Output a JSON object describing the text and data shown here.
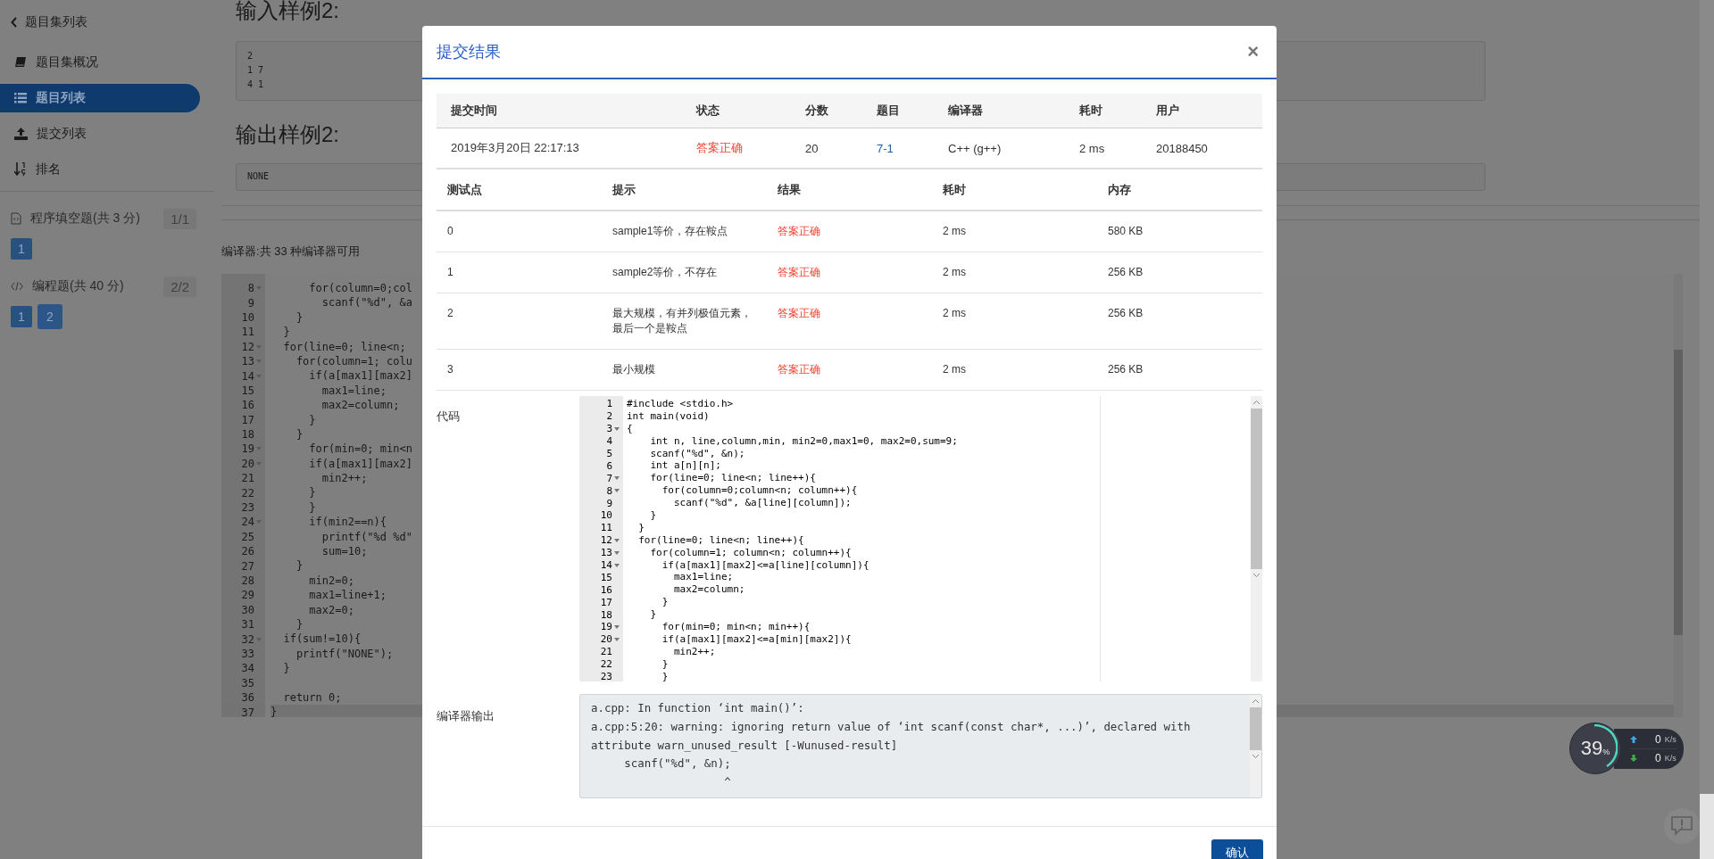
{
  "sidebar": {
    "back": {
      "label": "题目集列表"
    },
    "items": [
      {
        "label": "题目集概况",
        "selected": false
      },
      {
        "label": "题目列表",
        "selected": true
      },
      {
        "label": "提交列表",
        "selected": false
      },
      {
        "label": "排名",
        "selected": false
      }
    ],
    "sections": [
      {
        "title": "程序填空题(共 3 分)",
        "count": "1/1",
        "problems": [
          {
            "label": "1",
            "selected": false
          }
        ]
      },
      {
        "title": "编程题(共 40 分)",
        "count": "2/2",
        "problems": [
          {
            "label": "1",
            "selected": false
          },
          {
            "label": "2",
            "selected": true
          }
        ]
      }
    ]
  },
  "page": {
    "input_heading": "输入样例2:",
    "input_sample": [
      "2",
      "1 7",
      "4 1"
    ],
    "output_heading": "输出样例2:",
    "output_sample": "NONE",
    "compiler_note": "编译器:共 33 种编译器可用",
    "editor_lines": [
      {
        "n": "8",
        "code": "      for(column=0;col",
        "fold": true
      },
      {
        "n": "9",
        "code": "        scanf(\"%d\", &a",
        "fold": false
      },
      {
        "n": "10",
        "code": "    }",
        "fold": false
      },
      {
        "n": "11",
        "code": "  }",
        "fold": false
      },
      {
        "n": "12",
        "code": "  for(line=0; line<n;",
        "fold": true
      },
      {
        "n": "13",
        "code": "    for(column=1; colu",
        "fold": true
      },
      {
        "n": "14",
        "code": "      if(a[max1][max2]",
        "fold": true
      },
      {
        "n": "15",
        "code": "        max1=line;",
        "fold": false
      },
      {
        "n": "16",
        "code": "        max2=column;",
        "fold": false
      },
      {
        "n": "17",
        "code": "      }",
        "fold": false
      },
      {
        "n": "18",
        "code": "    }",
        "fold": false
      },
      {
        "n": "19",
        "code": "      for(min=0; min<n",
        "fold": true
      },
      {
        "n": "20",
        "code": "      if(a[max1][max2]",
        "fold": true
      },
      {
        "n": "21",
        "code": "        min2++;",
        "fold": false
      },
      {
        "n": "22",
        "code": "      }",
        "fold": false
      },
      {
        "n": "23",
        "code": "      }",
        "fold": false
      },
      {
        "n": "24",
        "code": "      if(min2==n){",
        "fold": true
      },
      {
        "n": "25",
        "code": "        printf(\"%d %d\"",
        "fold": false
      },
      {
        "n": "26",
        "code": "        sum=10;",
        "fold": false
      },
      {
        "n": "27",
        "code": "    }",
        "fold": false
      },
      {
        "n": "28",
        "code": "      min2=0;",
        "fold": false
      },
      {
        "n": "29",
        "code": "      max1=line+1;",
        "fold": false
      },
      {
        "n": "30",
        "code": "      max2=0;",
        "fold": false
      },
      {
        "n": "31",
        "code": "    }",
        "fold": false
      },
      {
        "n": "32",
        "code": "  if(sum!=10){",
        "fold": true
      },
      {
        "n": "33",
        "code": "    printf(\"NONE\");",
        "fold": false
      },
      {
        "n": "34",
        "code": "  }",
        "fold": false
      },
      {
        "n": "35",
        "fold": false
      },
      {
        "n": "36",
        "code": "  return 0;",
        "fold": false
      },
      {
        "n": "37",
        "code": "}",
        "fold": false
      }
    ]
  },
  "dialog": {
    "title": "提交结果",
    "close": "×",
    "summary": {
      "columns": [
        "提交时间",
        "状态",
        "分数",
        "题目",
        "编译器",
        "耗时",
        "用户"
      ],
      "cells": [
        {
          "text": "2019年3月20日 22:17:13",
          "kind": "plain"
        },
        {
          "text": "答案正确",
          "kind": "status"
        },
        {
          "text": "20",
          "kind": "plain"
        },
        {
          "text": "7-1",
          "kind": "link"
        },
        {
          "text": "C++ (g++)",
          "kind": "plain"
        },
        {
          "text": "2 ms",
          "kind": "plain"
        },
        {
          "text": "20188450",
          "kind": "plain"
        }
      ]
    },
    "tests": {
      "columns": [
        "测试点",
        "提示",
        "结果",
        "耗时",
        "内存"
      ],
      "rows": [
        {
          "case": "0",
          "hint": "sample1等价，存在鞍点",
          "result": "答案正确",
          "time": "2 ms",
          "memory": "580 KB"
        },
        {
          "case": "1",
          "hint": "sample2等价，不存在",
          "result": "答案正确",
          "time": "2 ms",
          "memory": "256 KB"
        },
        {
          "case": "2",
          "hint": "最大规模，有并列极值元素，最后一个是鞍点",
          "result": "答案正确",
          "time": "2 ms",
          "memory": "256 KB"
        },
        {
          "case": "3",
          "hint": "最小规模",
          "result": "答案正确",
          "time": "2 ms",
          "memory": "256 KB"
        }
      ]
    },
    "code_label": "代码",
    "code_lines": [
      {
        "n": "1",
        "code": "#include <stdio.h>",
        "fold": false
      },
      {
        "n": "2",
        "code": "int main(void)",
        "fold": false
      },
      {
        "n": "3",
        "code": "{",
        "fold": true
      },
      {
        "n": "4",
        "code": "    int n, line,column,min, min2=0,max1=0, max2=0,sum=9;",
        "fold": false
      },
      {
        "n": "5",
        "code": "    scanf(\"%d\", &n);",
        "fold": false
      },
      {
        "n": "6",
        "code": "    int a[n][n];",
        "fold": false
      },
      {
        "n": "7",
        "code": "    for(line=0; line<n; line++){",
        "fold": true
      },
      {
        "n": "8",
        "code": "      for(column=0;column<n; column++){",
        "fold": true
      },
      {
        "n": "9",
        "code": "        scanf(\"%d\", &a[line][column]);",
        "fold": false
      },
      {
        "n": "10",
        "code": "    }",
        "fold": false
      },
      {
        "n": "11",
        "code": "  }",
        "fold": false
      },
      {
        "n": "12",
        "code": "  for(line=0; line<n; line++){",
        "fold": true
      },
      {
        "n": "13",
        "code": "    for(column=1; column<n; column++){",
        "fold": true
      },
      {
        "n": "14",
        "code": "      if(a[max1][max2]<=a[line][column]){",
        "fold": true
      },
      {
        "n": "15",
        "code": "        max1=line;",
        "fold": false
      },
      {
        "n": "16",
        "code": "        max2=column;",
        "fold": false
      },
      {
        "n": "17",
        "code": "      }",
        "fold": false
      },
      {
        "n": "18",
        "code": "    }",
        "fold": false
      },
      {
        "n": "19",
        "code": "      for(min=0; min<n; min++){",
        "fold": true
      },
      {
        "n": "20",
        "code": "      if(a[max1][max2]<=a[min][max2]){",
        "fold": true
      },
      {
        "n": "21",
        "code": "        min2++;",
        "fold": false
      },
      {
        "n": "22",
        "code": "      }",
        "fold": false
      },
      {
        "n": "23",
        "code": "      }",
        "fold": false
      }
    ],
    "output_label": "编译器输出",
    "output_lines": [
      "a.cpp: In function ‘int main()’:",
      "a.cpp:5:20: warning: ignoring return value of ‘int scanf(const char*, ...)’, declared with",
      "attribute warn_unused_result [-Wunused-result]",
      "     scanf(\"%d\", &n);",
      "                    ^"
    ],
    "confirm": "确认"
  },
  "monitor": {
    "percent": "39",
    "unit": "%",
    "up": {
      "value": "0",
      "unit": "K/s"
    },
    "down": {
      "value": "0",
      "unit": "K/s"
    }
  }
}
